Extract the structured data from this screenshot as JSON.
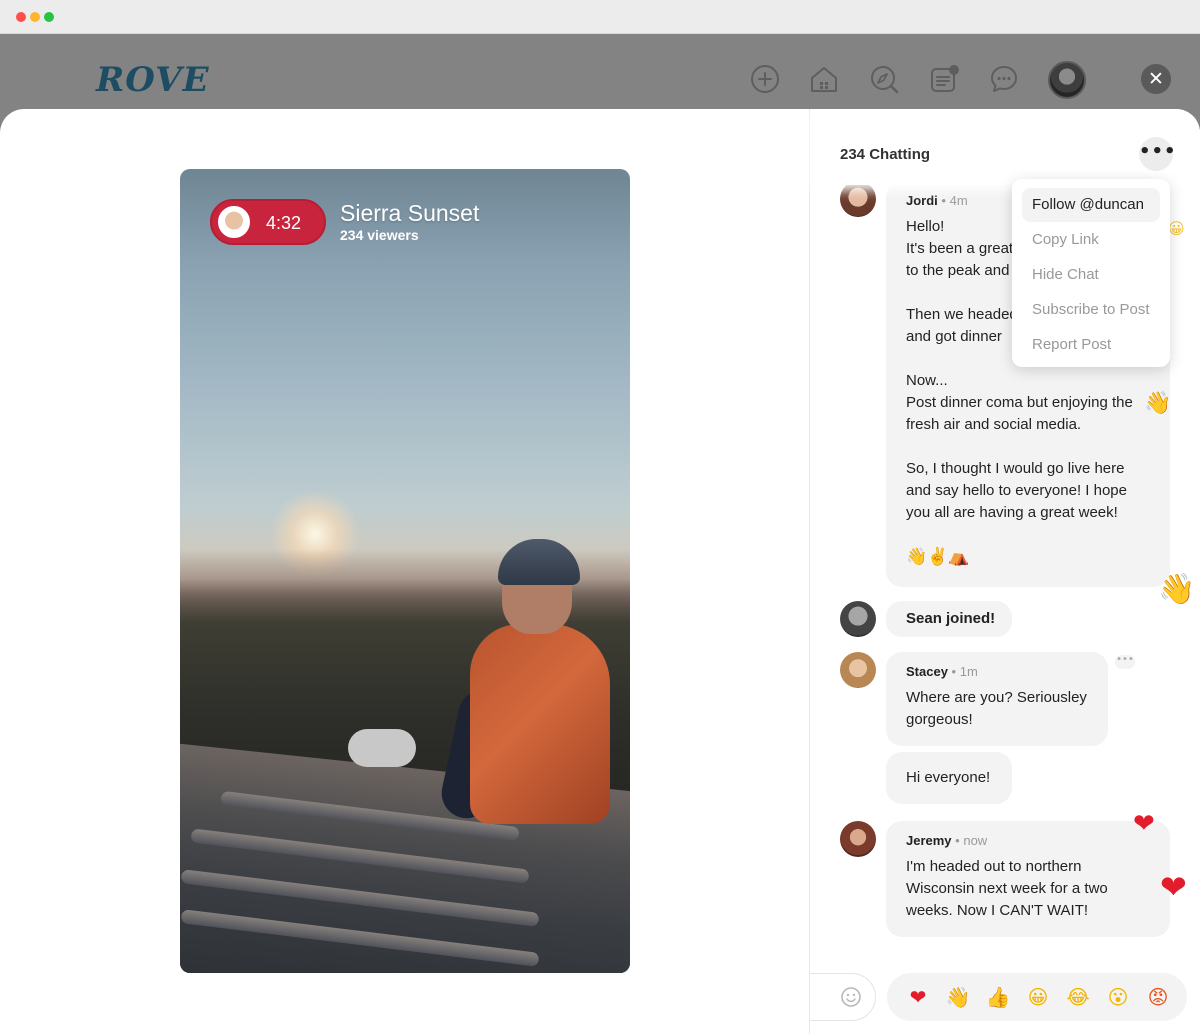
{
  "app": {
    "logo": "ROVE"
  },
  "stream": {
    "timer": "4:32",
    "title": "Sierra Sunset",
    "viewers": "234 viewers"
  },
  "chat": {
    "header": "234 Chatting",
    "more_label": "•••",
    "menu": [
      {
        "label": "Follow @duncan"
      },
      {
        "label": "Copy Link"
      },
      {
        "label": "Hide Chat"
      },
      {
        "label": "Subscribe to Post"
      },
      {
        "label": "Report Post"
      }
    ],
    "messages": [
      {
        "name": "Jordi",
        "time": "• 4m",
        "lines": [
          "Hello!",
          "It's been a great",
          "to the peak and",
          "",
          "Then we headed",
          "and got dinner",
          "",
          "Now...",
          "Post dinner coma but enjoying the",
          "fresh air and social media.",
          "",
          "So, I thought I would go live here",
          "and say hello to everyone! I hope",
          "you all are having a great week!",
          "",
          "👋✌️⛺"
        ]
      },
      {
        "system": "Sean joined!"
      },
      {
        "name": "Stacey",
        "time": "• 1m",
        "lines": [
          "Where are you? Seriousley",
          "gorgeous!"
        ]
      },
      {
        "text": "Hi everyone!"
      },
      {
        "name": "Jeremy",
        "time": "• now",
        "lines": [
          "I'm headed out to northern",
          "Wisconsin next week for a two",
          "weeks. Now I CAN'T WAIT!"
        ]
      }
    ],
    "floating": [
      "😀",
      "👋",
      "👋",
      "❤",
      "❤"
    ]
  },
  "composer": {
    "placeholder": ""
  },
  "reactions": [
    {
      "glyph": "❤",
      "color": "#e21d2b"
    },
    {
      "glyph": "👋",
      "color": "#f4b400"
    },
    {
      "glyph": "👍",
      "color": "#f4b400"
    },
    {
      "glyph": "😀",
      "color": "#f4b400"
    },
    {
      "glyph": "😂",
      "color": "#f4b400"
    },
    {
      "glyph": "😮",
      "color": "#f4b400"
    },
    {
      "glyph": "😡",
      "color": "#e8541e"
    }
  ]
}
